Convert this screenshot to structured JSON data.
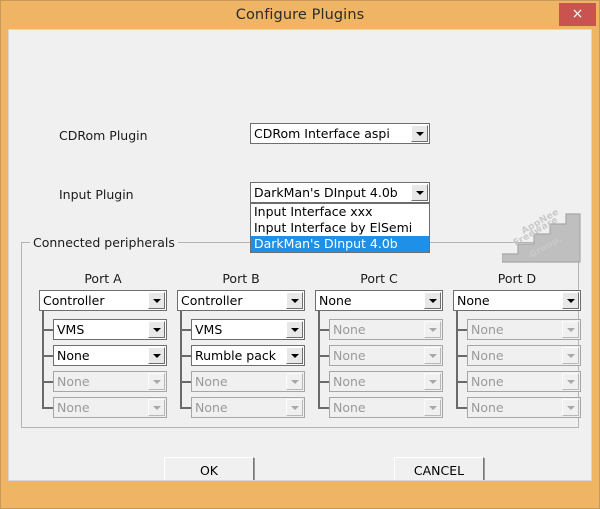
{
  "window": {
    "title": "Configure Plugins",
    "close_label": "×",
    "accent_color": "#efb464",
    "close_color": "#c9544f",
    "client_bg": "#f0f0f0"
  },
  "fields": {
    "cdrom": {
      "label": "CDRom Plugin",
      "value": "CDRom Interface aspi"
    },
    "input": {
      "label": "Input Plugin",
      "value": "DarkMan's DInput 4.0b",
      "expanded": true,
      "options": [
        "Input Interface xxx",
        "Input Interface by ElSemi",
        "DarkMan's DInput 4.0b"
      ],
      "selected_index": 2,
      "highlight_color": "#1e90e8"
    }
  },
  "peripherals": {
    "group_label": "Connected peripherals",
    "ports": [
      {
        "title": "Port A",
        "main": {
          "value": "Controller",
          "enabled": true
        },
        "slots": [
          {
            "value": "VMS",
            "enabled": true
          },
          {
            "value": "None",
            "enabled": true
          },
          {
            "value": "None",
            "enabled": false
          },
          {
            "value": "None",
            "enabled": false
          }
        ]
      },
      {
        "title": "Port B",
        "main": {
          "value": "Controller",
          "enabled": true
        },
        "slots": [
          {
            "value": "VMS",
            "enabled": true
          },
          {
            "value": "Rumble pack",
            "enabled": true
          },
          {
            "value": "None",
            "enabled": false
          },
          {
            "value": "None",
            "enabled": false
          }
        ]
      },
      {
        "title": "Port C",
        "main": {
          "value": "None",
          "enabled": true
        },
        "slots": [
          {
            "value": "None",
            "enabled": false
          },
          {
            "value": "None",
            "enabled": false
          },
          {
            "value": "None",
            "enabled": false
          },
          {
            "value": "None",
            "enabled": false
          }
        ]
      },
      {
        "title": "Port D",
        "main": {
          "value": "None",
          "enabled": true
        },
        "slots": [
          {
            "value": "None",
            "enabled": false
          },
          {
            "value": "None",
            "enabled": false
          },
          {
            "value": "None",
            "enabled": false
          },
          {
            "value": "None",
            "enabled": false
          }
        ]
      }
    ]
  },
  "buttons": {
    "ok": "OK",
    "cancel": "CANCEL"
  },
  "watermark": {
    "line1": "AppNee",
    "line2": "Freeware",
    "line3": "Group."
  }
}
